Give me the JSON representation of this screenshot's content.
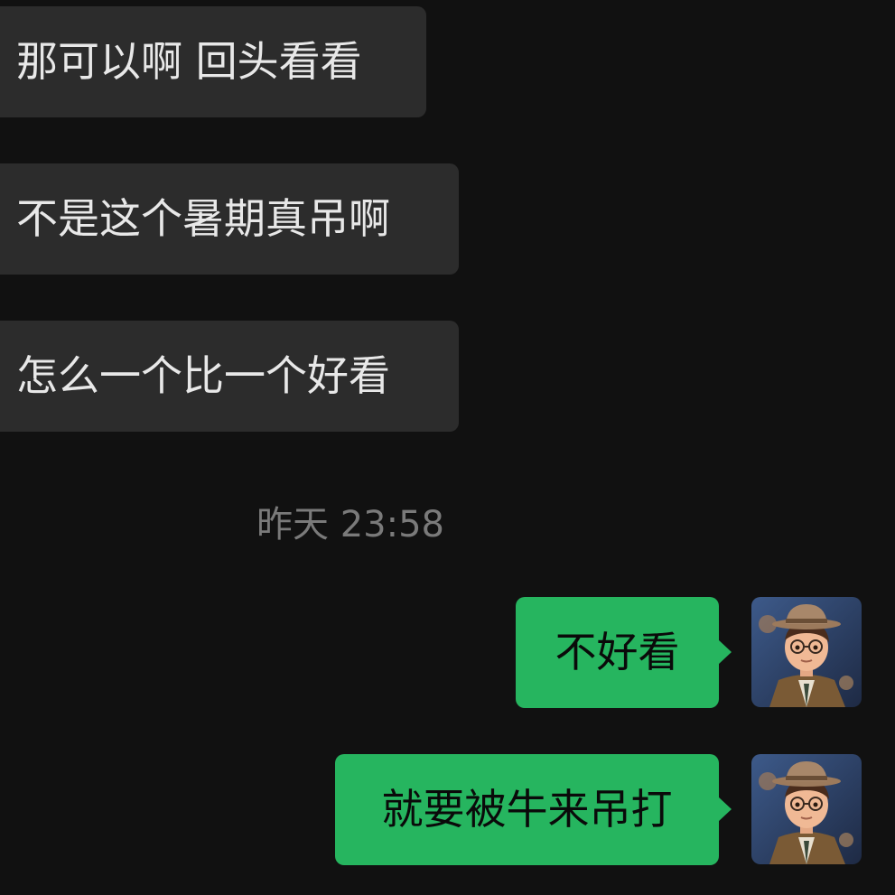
{
  "messages_in": [
    {
      "text": "那可以啊 回头看看"
    },
    {
      "text": "不是这个暑期真吊啊"
    },
    {
      "text": "怎么一个比一个好看"
    }
  ],
  "timestamp": "昨天 23:58",
  "messages_out": [
    {
      "text": "不好看",
      "avatar_icon": "cartoon-man-hat-avatar"
    },
    {
      "text": "就要被牛来吊打",
      "avatar_icon": "cartoon-man-hat-avatar"
    }
  ],
  "colors": {
    "background": "#111111",
    "incoming_bubble": "#2c2c2c",
    "outgoing_bubble": "#26b55f",
    "timestamp_text": "#7a7a7a"
  }
}
